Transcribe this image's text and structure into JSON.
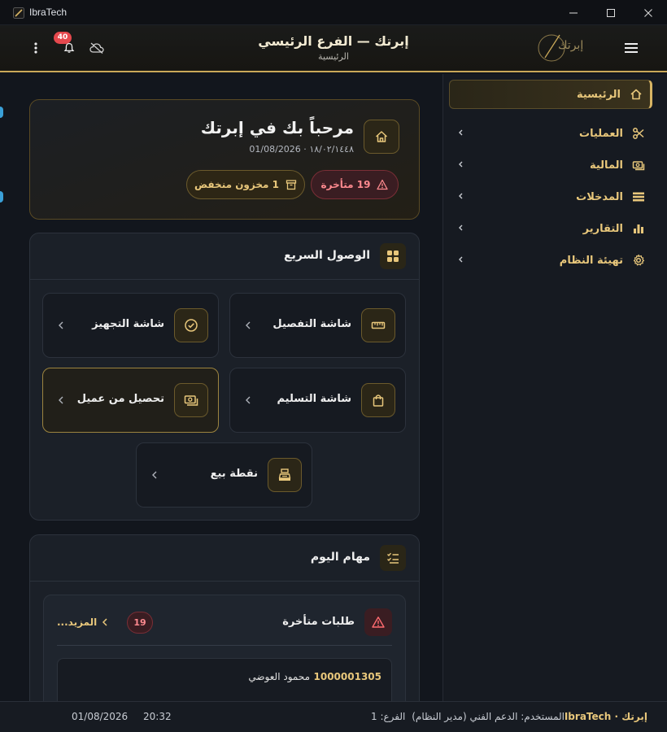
{
  "window": {
    "title": "IbraTech"
  },
  "header": {
    "title": "إبرتك — الفرع الرئيسي",
    "subtitle": "الرئيسية",
    "notification_count": "40",
    "logo_text": "إبرتك"
  },
  "welcome": {
    "title": "مرحباً بك في إبرتك",
    "date": "١٨/٠٢/١٤٤٨ · 01/08/2026",
    "overdue_label": "19 متأخرة",
    "low_stock_label": "1 مخزون منخفض"
  },
  "quick_access": {
    "title": "الوصول السريع",
    "tiles": [
      {
        "label": "شاشة التفصيل",
        "icon": "ruler-icon"
      },
      {
        "label": "شاشة التجهيز",
        "icon": "check-circle-icon"
      },
      {
        "label": "شاشة التسليم",
        "icon": "shopping-bag-icon"
      },
      {
        "label": "تحصيل من عميل",
        "icon": "cash-icon"
      },
      {
        "label": "نقطة بيع",
        "icon": "cash-register-icon"
      }
    ]
  },
  "tasks": {
    "title": "مهام اليوم",
    "overdue_title": "طلبات متأخرة",
    "overdue_count": "19",
    "more_label": "المزيد...",
    "rows": [
      {
        "number": "1000001305",
        "name": "محمود العوضي"
      }
    ]
  },
  "sidebar": {
    "items": [
      {
        "label": "الرئيسية",
        "icon": "home-icon",
        "active": true
      },
      {
        "label": "العمليات",
        "icon": "scissors-icon",
        "active": false
      },
      {
        "label": "المالية",
        "icon": "cash-icon",
        "active": false
      },
      {
        "label": "المدخلات",
        "icon": "list-icon",
        "active": false
      },
      {
        "label": "التقارير",
        "icon": "bar-chart-icon",
        "active": false
      },
      {
        "label": "تهيئة النظام",
        "icon": "gear-icon",
        "active": false
      }
    ]
  },
  "statusbar": {
    "brand": "إبرتك · IbraTech",
    "user": "المستخدم: الدعم الفني (مدير النظام)",
    "branch": "الفرع: 1",
    "time": "20:32",
    "date": "01/08/2026"
  },
  "colors": {
    "accent": "#d8b564",
    "danger": "#e5484d",
    "background": "#12161d"
  }
}
